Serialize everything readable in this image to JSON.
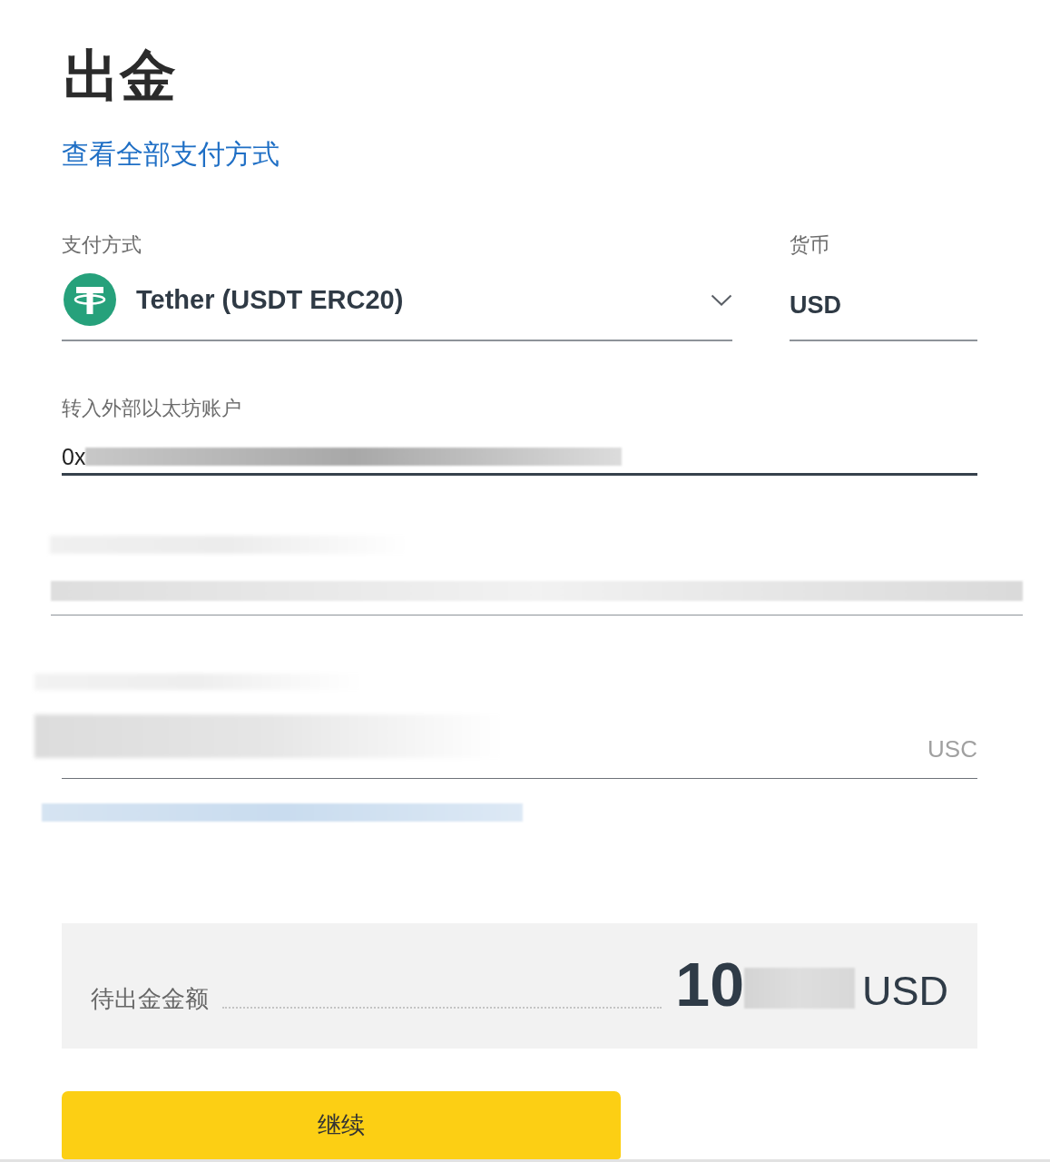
{
  "page": {
    "title": "出金",
    "link": "查看全部支付方式"
  },
  "payment_method": {
    "label": "支付方式",
    "value": "Tether (USDT ERC20)"
  },
  "currency": {
    "label": "货币",
    "value": "USD"
  },
  "address": {
    "label": "转入外部以太坊账户",
    "value": "0x"
  },
  "amount_input": {
    "unit": "USC"
  },
  "summary": {
    "label": "待出金金额",
    "amount": "10",
    "currency": "USD"
  },
  "continue_button": {
    "label": "继续"
  }
}
